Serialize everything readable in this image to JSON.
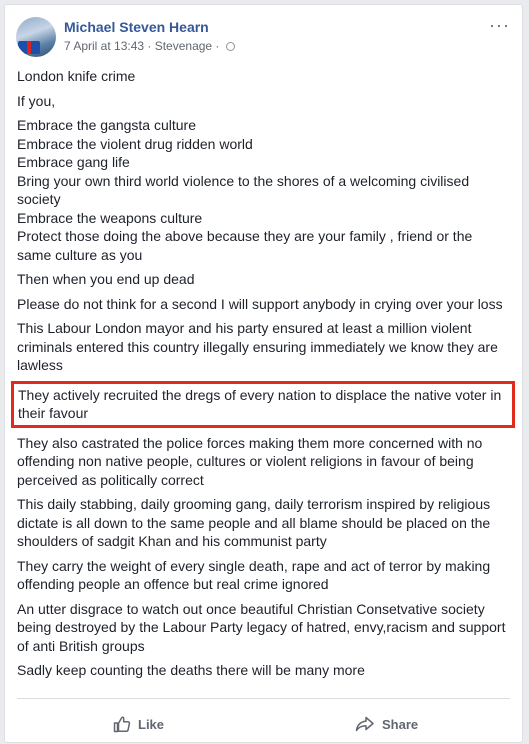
{
  "post": {
    "author": "Michael Steven Hearn",
    "meta": "7 April at 13:43 · Stevenage ·",
    "more_label": "···",
    "paragraphs": [
      "London knife crime",
      "If you,",
      "Embrace the gangsta culture\nEmbrace the violent drug ridden world\nEmbrace gang life\nBring your own third world violence to the shores of a welcoming civilised society\nEmbrace the weapons culture\nProtect those doing the above because they are your family , friend or the same culture as you",
      "Then when you end up dead",
      "Please do not think for a second I will support anybody in crying over your loss",
      "This Labour London mayor and his party ensured at least a million violent criminals entered this country illegally ensuring immediately we know they are lawless",
      "They actively recruited the dregs of every nation to displace the native voter in their favour",
      "They also castrated the police forces making them more concerned with no offending non native people, cultures or violent religions in favour of being perceived as politically correct",
      "This daily stabbing, daily grooming gang, daily terrorism inspired by religious dictate is all down to the same people and all blame should be placed on the shoulders of sadgit Khan and his communist party",
      "They carry the weight of every single death, rape and act of terror by making offending people an offence but real crime ignored",
      "An utter disgrace to watch out once beautiful Christian Consetvative society being destroyed by the Labour Party legacy of hatred, envy,racism and support of anti British groups",
      "Sadly keep counting the deaths there will be many more"
    ],
    "highlighted_paragraph_index": 6,
    "highlight_color": "#e02a1b"
  },
  "actions": {
    "like_label": "Like",
    "share_label": "Share"
  },
  "colors": {
    "author_link": "#365899",
    "meta_gray": "#606770",
    "text": "#1d2129"
  }
}
